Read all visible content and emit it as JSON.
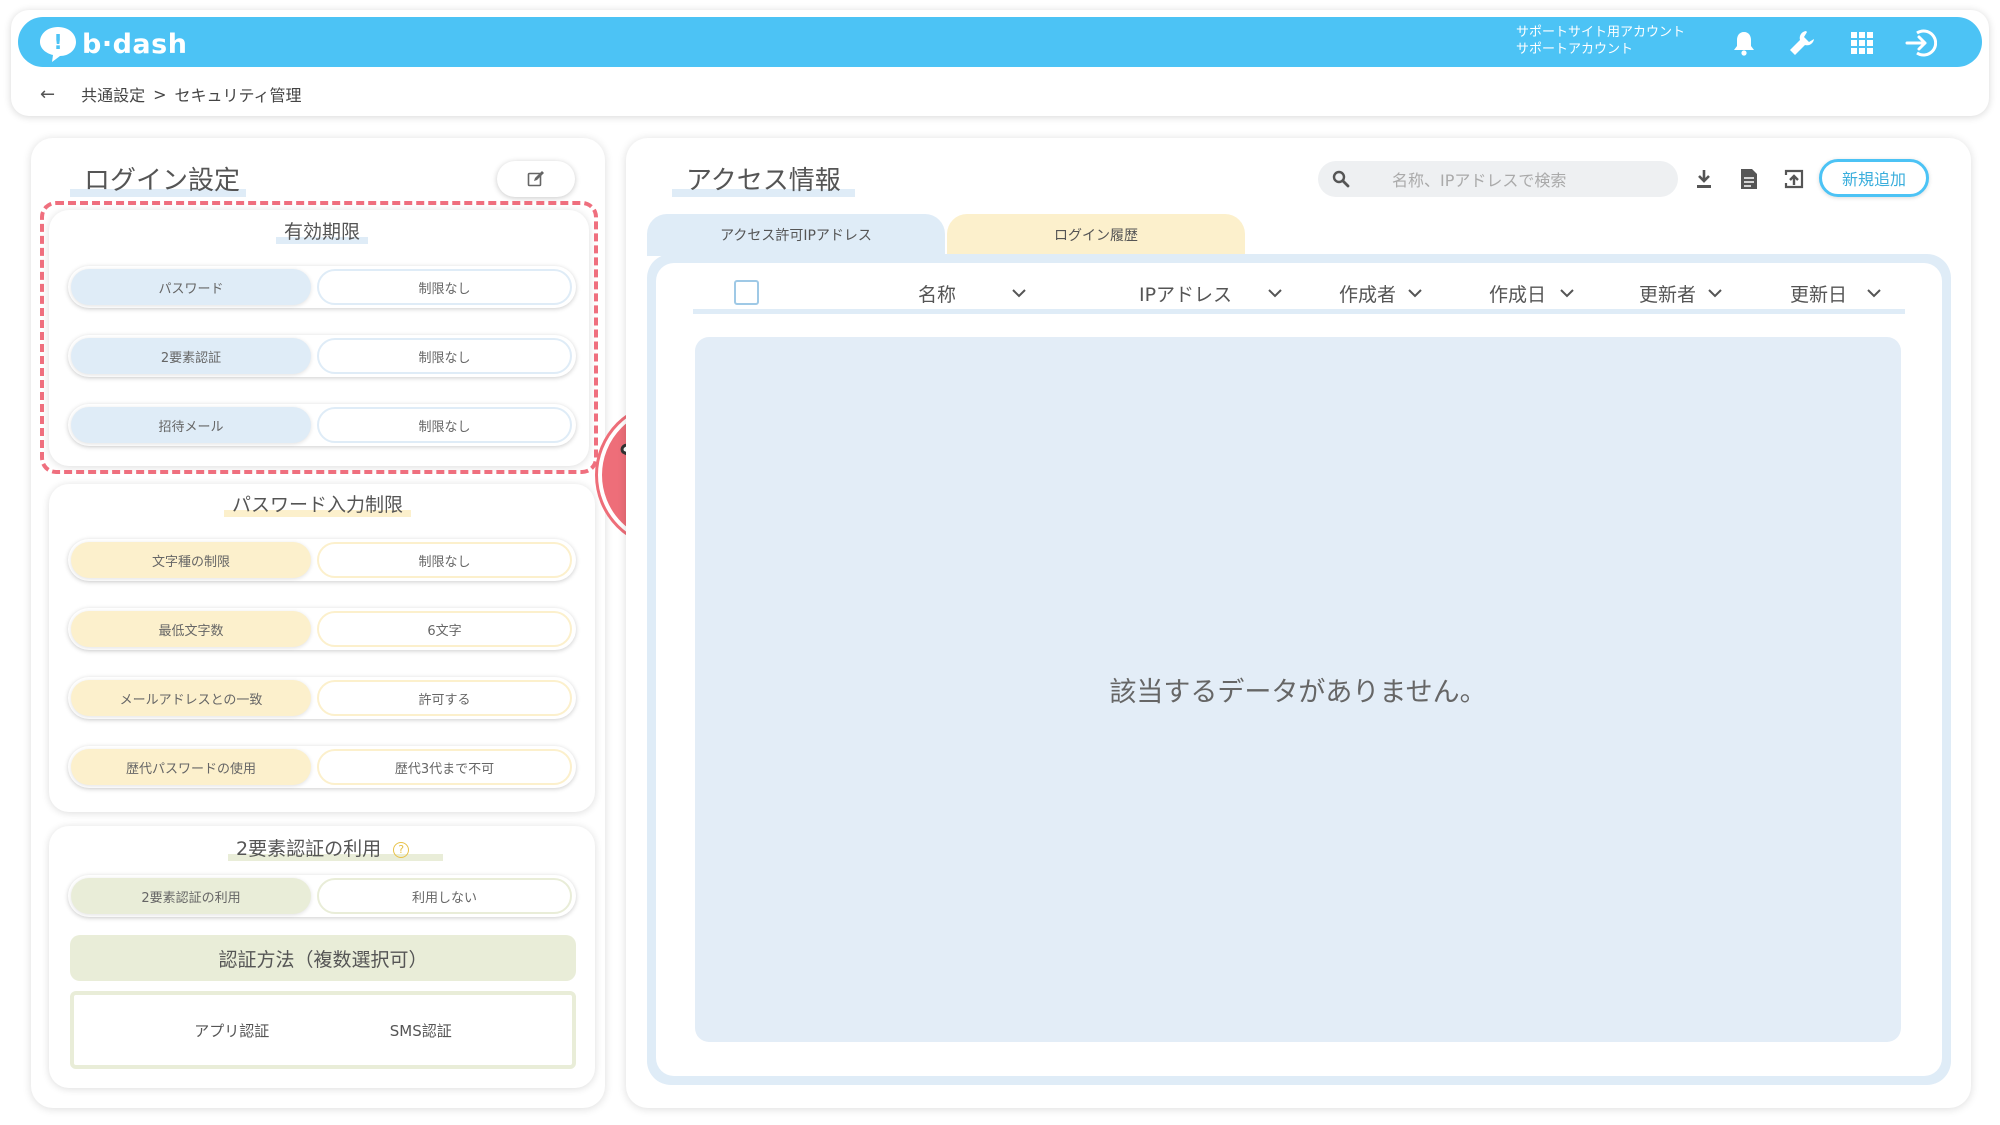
{
  "header": {
    "logo_text": "b·dash",
    "account_line1": "サポートサイト用アカウント",
    "account_line2": "サポートアカウント",
    "icons": [
      "bell-icon",
      "wrench-icon",
      "grid-icon",
      "logout-icon"
    ]
  },
  "breadcrumb": {
    "back": "←",
    "level1": "共通設定",
    "separator": ">",
    "level2": "セキュリティ管理"
  },
  "login_settings": {
    "title": "ログイン設定",
    "expiry": {
      "title": "有効期限",
      "rows": [
        {
          "label": "パスワード",
          "value": "制限なし"
        },
        {
          "label": "2要素認証",
          "value": "制限なし"
        },
        {
          "label": "招待メール",
          "value": "制限なし"
        }
      ]
    },
    "password_rules": {
      "title": "パスワード入力制限",
      "rows": [
        {
          "label": "文字種の制限",
          "value": "制限なし"
        },
        {
          "label": "最低文字数",
          "value": "6文字"
        },
        {
          "label": "メールアドレスとの一致",
          "value": "許可する"
        },
        {
          "label": "歴代パスワードの使用",
          "value": "歴代3代まで不可"
        }
      ]
    },
    "two_factor": {
      "title": "2要素認証の利用",
      "rows": [
        {
          "label": "2要素認証の利用",
          "value": "利用しない"
        }
      ],
      "method_title": "認証方法（複数選択可）",
      "methods": [
        "アプリ認証",
        "SMS認証"
      ]
    }
  },
  "access_info": {
    "title": "アクセス情報",
    "search_placeholder": "名称、IPアドレスで検索",
    "new_button": "新規追加",
    "tabs": [
      "アクセス許可IPアドレス",
      "ログイン履歴"
    ],
    "columns": [
      "名称",
      "IPアドレス",
      "作成者",
      "作成日",
      "更新者",
      "更新日"
    ],
    "empty_message": "該当するデータがありません。"
  },
  "colors": {
    "brand": "#4cc3f5",
    "highlight_dash": "#ef6f7e",
    "blue_chip": "#dfecf7",
    "yellow_chip": "#fcf0cc",
    "green_chip": "#e9edd8"
  }
}
